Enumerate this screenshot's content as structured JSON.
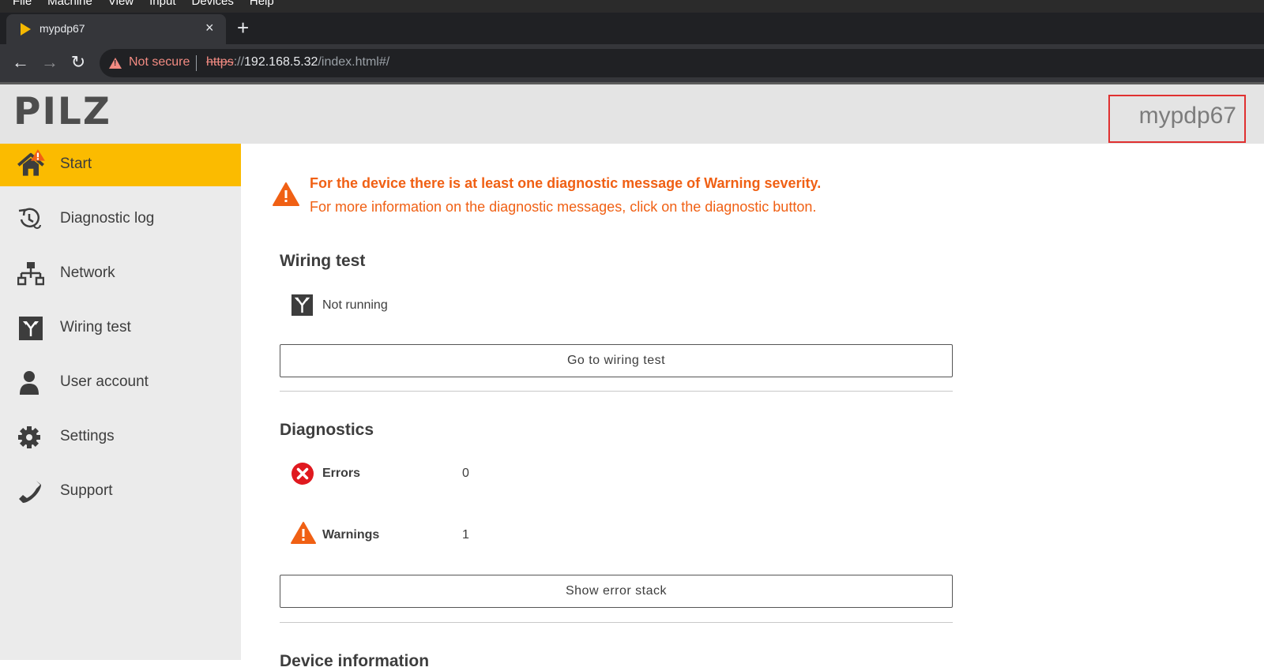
{
  "os_menu": [
    "File",
    "Machine",
    "View",
    "Input",
    "Devices",
    "Help"
  ],
  "browser": {
    "tab_title": "mypdp67",
    "tab_close": "×",
    "new_tab": "+",
    "back": "←",
    "forward": "→",
    "reload": "↻",
    "security_text": "Not secure",
    "url_scheme": "https",
    "url_sep": "://",
    "url_host": "192.168.5.32",
    "url_path": "/index.html#/"
  },
  "header": {
    "logo": "PILZ",
    "device_name": "mypdp67"
  },
  "sidebar": {
    "items": [
      {
        "label": "Start",
        "icon": "home-icon",
        "active": true
      },
      {
        "label": "Diagnostic log",
        "icon": "history-icon"
      },
      {
        "label": "Network",
        "icon": "network-icon"
      },
      {
        "label": "Wiring test",
        "icon": "wiring-test-icon"
      },
      {
        "label": "User account",
        "icon": "user-icon"
      },
      {
        "label": "Settings",
        "icon": "gear-icon"
      },
      {
        "label": "Support",
        "icon": "phone-icon"
      }
    ]
  },
  "alert": {
    "title": "For the device there is at least one diagnostic message of Warning severity.",
    "text": "For more information on the diagnostic messages, click on the diagnostic button."
  },
  "wiring_test": {
    "title": "Wiring test",
    "status": "Not running",
    "button": "Go to wiring test"
  },
  "diagnostics": {
    "title": "Diagnostics",
    "errors_label": "Errors",
    "errors_value": "0",
    "warnings_label": "Warnings",
    "warnings_value": "1",
    "button": "Show error stack"
  },
  "next_section_title": "Device information",
  "colors": {
    "accent": "#fbbb00",
    "warning": "#f06014",
    "error": "#e0191f",
    "sidebar_bg": "#ebebeb",
    "header_bg": "#e4e4e4"
  }
}
